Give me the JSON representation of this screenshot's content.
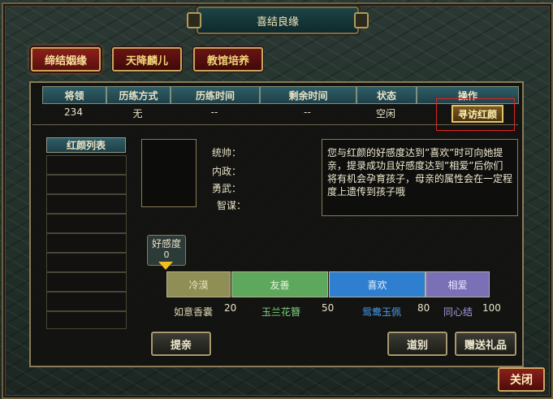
{
  "window": {
    "title": "喜结良缘"
  },
  "tabs": [
    {
      "label": "缔结姻缘",
      "active": true
    },
    {
      "label": "天降麟儿",
      "active": false
    },
    {
      "label": "教馆培养",
      "active": false
    }
  ],
  "table": {
    "headers": [
      "将领",
      "历练方式",
      "历练时间",
      "剩余时间",
      "状态",
      "操作"
    ],
    "row": {
      "general": "234",
      "method": "无",
      "train_time": "--",
      "remaining": "--",
      "status": "空闲",
      "action": "寻访红颜"
    }
  },
  "beauty_list": {
    "header": "红颜列表"
  },
  "attributes": [
    "统帅：",
    "内政：",
    "勇武：",
    "智谋："
  ],
  "description": "您与红颜的好感度达到”喜欢”时可向她提亲，提录成功且好感度达到”相爱”后你们将有机会孕育孩子，母亲的属性会在一定程度上遗传到孩子哦",
  "favor": {
    "label": "好感度",
    "value": "0",
    "level": 0
  },
  "segments": [
    {
      "label": "冷漠",
      "color": "#8f8e55",
      "text_color": "#e8e6c0"
    },
    {
      "label": "友善",
      "color": "#5ea85e",
      "text_color": "#e8f4d8"
    },
    {
      "label": "喜欢",
      "color": "#2f7fd0",
      "text_color": "#e8f0ff"
    },
    {
      "label": "相爱",
      "color": "#7a70b8",
      "text_color": "#ece8ff"
    }
  ],
  "gifts": [
    {
      "name": "如意香囊",
      "color": "#d8d2b0"
    },
    {
      "name": "玉兰花簪",
      "color": "#7ed07e"
    },
    {
      "name": "鸳鸯玉佩",
      "color": "#4a9ae8"
    },
    {
      "name": "同心结",
      "color": "#a49ae0"
    }
  ],
  "thresholds": [
    "20",
    "50",
    "80",
    "100"
  ],
  "buttons": {
    "propose": "提亲",
    "farewell": "道别",
    "gift": "赠送礼品",
    "close": "关闭"
  }
}
